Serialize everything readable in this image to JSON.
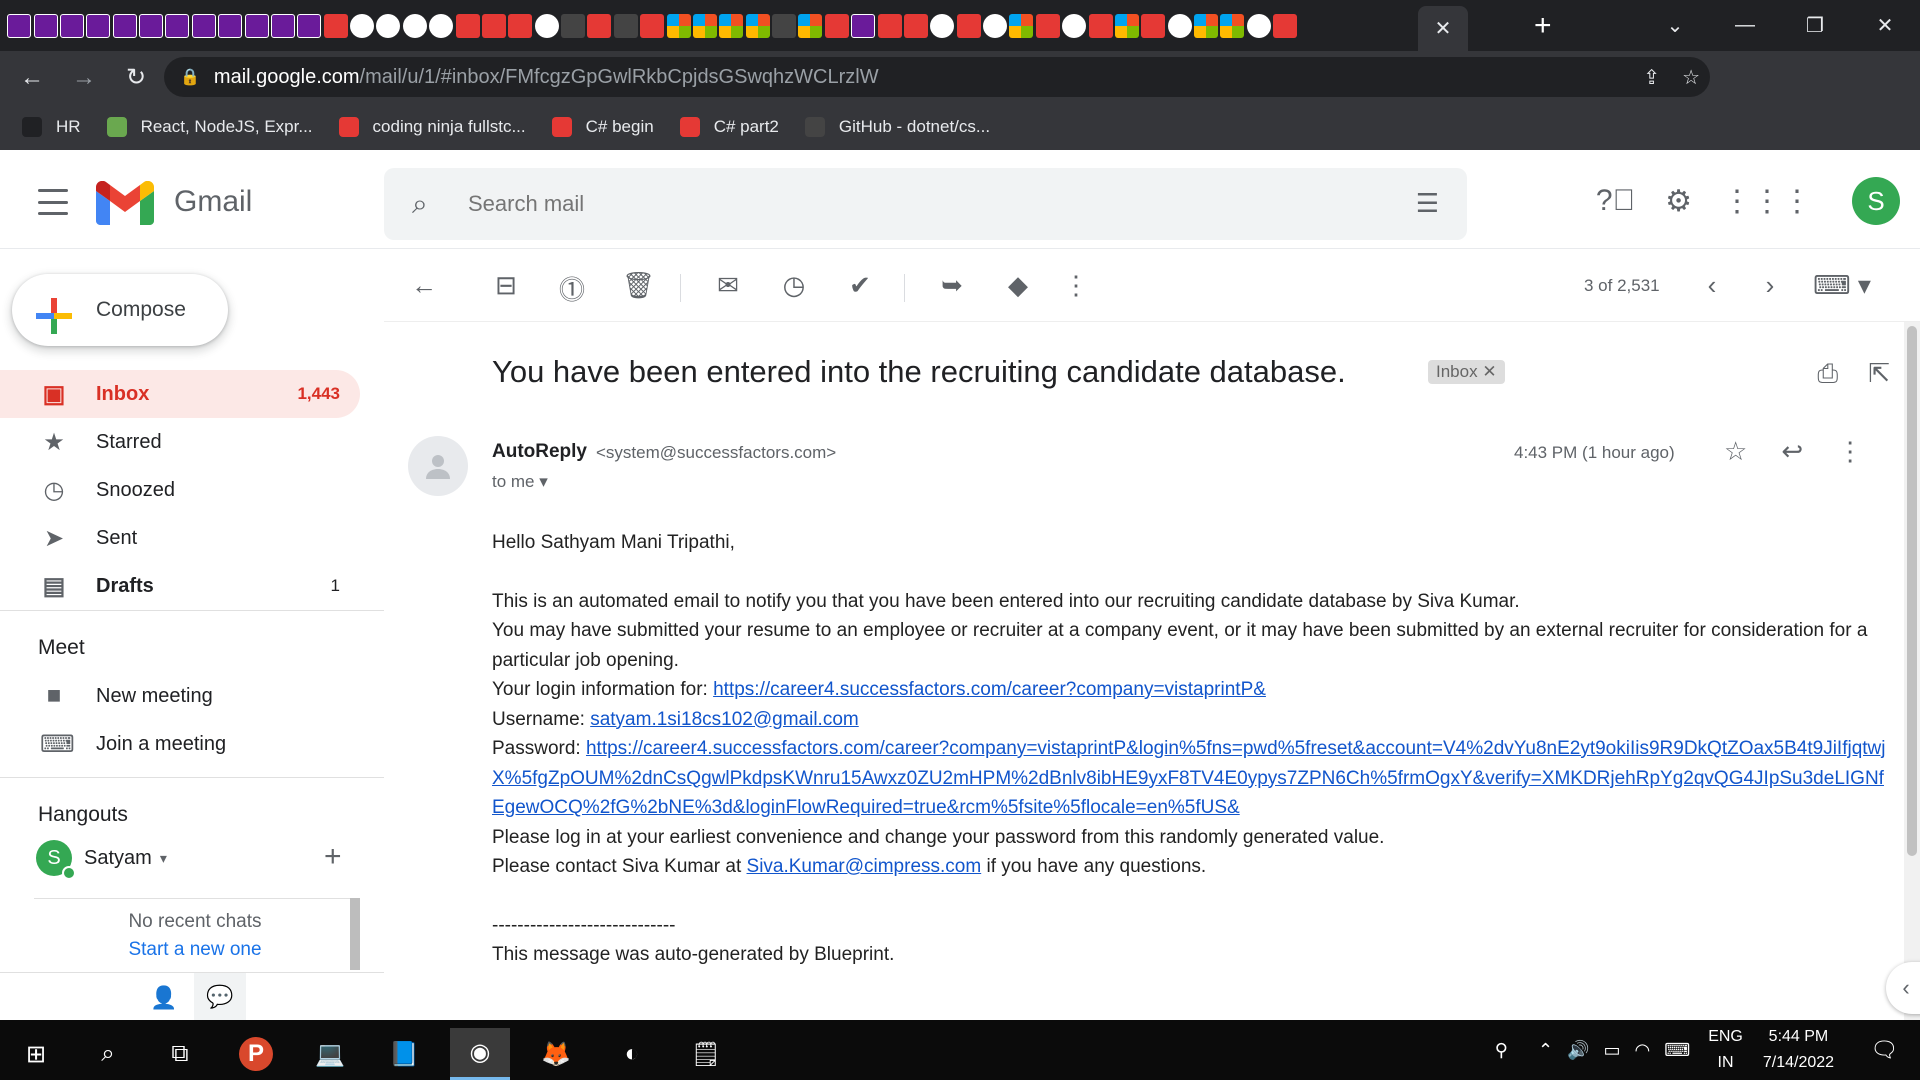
{
  "browser": {
    "tab_favicons": [
      "b",
      "b",
      "b",
      "b",
      "b",
      "b",
      "b",
      "b",
      "b",
      "b",
      "b",
      "b",
      "y",
      "g",
      "g",
      "g",
      "g",
      "y",
      "y",
      "y",
      "g",
      "h",
      "y",
      "h",
      "y",
      "m",
      "m",
      "m",
      "m",
      "h",
      "m",
      "y",
      "b",
      "y",
      "y",
      "g",
      "y",
      "g",
      "m",
      "y",
      "g",
      "y",
      "m",
      "y",
      "g",
      "m",
      "m",
      "g",
      "y"
    ],
    "active_tab_close": "✕",
    "new_tab": "+",
    "url_host": "mail.google.com",
    "url_path": "/mail/u/1/#inbox/FMfcgzGpGwlRkbCpjdsGSwqhzWCLrzlW",
    "bookmarks": [
      {
        "label": "HR",
        "icon": "globe-icon",
        "color": "#202124"
      },
      {
        "label": "React, NodeJS, Expr...",
        "icon": "c-icon",
        "color": "#6aa84f"
      },
      {
        "label": "coding ninja fullstc...",
        "icon": "m-icon",
        "color": "#e53935"
      },
      {
        "label": "C# begin",
        "icon": "youtube-icon",
        "color": "#e53935"
      },
      {
        "label": "C# part2",
        "icon": "youtube-icon",
        "color": "#e53935"
      },
      {
        "label": "GitHub - dotnet/cs...",
        "icon": "github-icon",
        "color": "#444"
      }
    ]
  },
  "gmail": {
    "app_name": "Gmail",
    "search_placeholder": "Search mail",
    "account_initial": "S",
    "compose_label": "Compose",
    "nav": [
      {
        "label": "Inbox",
        "count": "1,443",
        "icon": "inbox-icon"
      },
      {
        "label": "Starred",
        "count": "",
        "icon": "star-icon"
      },
      {
        "label": "Snoozed",
        "count": "",
        "icon": "clock-icon"
      },
      {
        "label": "Sent",
        "count": "",
        "icon": "send-icon"
      },
      {
        "label": "Drafts",
        "count": "1",
        "icon": "draft-icon"
      }
    ],
    "meet_title": "Meet",
    "meet_items": [
      {
        "label": "New meeting",
        "icon": "video-icon"
      },
      {
        "label": "Join a meeting",
        "icon": "keyboard-icon"
      }
    ],
    "hangouts_title": "Hangouts",
    "hangouts_user": "Satyam",
    "hangouts_user_initial": "S",
    "no_recent": "No recent chats",
    "start_new": "Start a new one",
    "pager": "3 of 2,531"
  },
  "email": {
    "subject": "You have been entered into the recruiting candidate database.",
    "label": "Inbox",
    "sender_name": "AutoReply",
    "sender_email": "<system@successfactors.com>",
    "to": "to me",
    "time": "4:43 PM (1 hour ago)",
    "greeting": "Hello Sathyam Mani Tripathi,",
    "line1": "This is an automated email to notify you that you have been entered into our recruiting candidate database by Siva Kumar.",
    "line2": "You may have submitted your resume to an employee or recruiter at a company event, or it may have been submitted by an external recruiter for consideration for a particular job opening.",
    "login_prefix": "Your login information for: ",
    "login_link": "https://career4.successfactors.com/career?company=vistaprintP&",
    "username_prefix": "Username: ",
    "username": "satyam.1si18cs102@gmail.com",
    "password_prefix": "Password: ",
    "password_link": "https://career4.successfactors.com/career?company=vistaprintP&login%5fns=pwd%5freset&account=V4%2dvYu8nE2yt9okiIis9R9DkQtZOax5B4t9JiIfjqtwjX%5fgZpOUM%2dnCsQgwlPkdpsKWnru15Awxz0ZU2mHPM%2dBnlv8ibHE9yxF8TV4E0ypys7ZPN6Ch%5frmOgxY&verify=XMKDRjehRpYg2qvQG4JIpSu3deLIGNfEgewOCQ%2fG%2bNE%3d&loginFlowRequired=true&rcm%5fsite%5flocale=en%5fUS&",
    "line_login": "Please log in at your earliest convenience and change your password from this randomly generated value.",
    "contact_prefix": "Please contact Siva Kumar at ",
    "contact_email": "Siva.Kumar@cimpress.com",
    "contact_suffix": " if you have any questions.",
    "separator": "-----------------------------",
    "footer": "This message was auto-generated by Blueprint."
  },
  "taskbar": {
    "lang_top": "ENG",
    "lang_bottom": "IN",
    "time": "5:44 PM",
    "date": "7/14/2022"
  },
  "colors": {
    "chrome_dark": "#202124",
    "gmail_red": "#d93025",
    "link_blue": "#1155cc",
    "account_green": "#34a853"
  }
}
